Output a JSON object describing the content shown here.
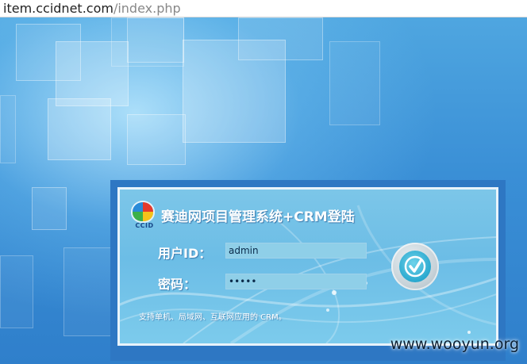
{
  "browser": {
    "url_host": "item.ccidnet.com",
    "url_path": "/index.php"
  },
  "login": {
    "logo_text": "CCID",
    "title": "赛迪网项目管理系统+CRM登陆",
    "user_label": "用户ID：",
    "user_value": "admin",
    "password_label": "密码：",
    "password_value": "•••••",
    "footer_note": "支持单机、局域网、互联网应用的 CRM。"
  },
  "watermark": "www.wooyun.org",
  "colors": {
    "background": "#3a86d0",
    "panel": "#7cc6e8",
    "frame": "#2e77c3"
  },
  "icons": {
    "logo": "ccid-logo-icon",
    "submit": "checkmark-icon"
  }
}
